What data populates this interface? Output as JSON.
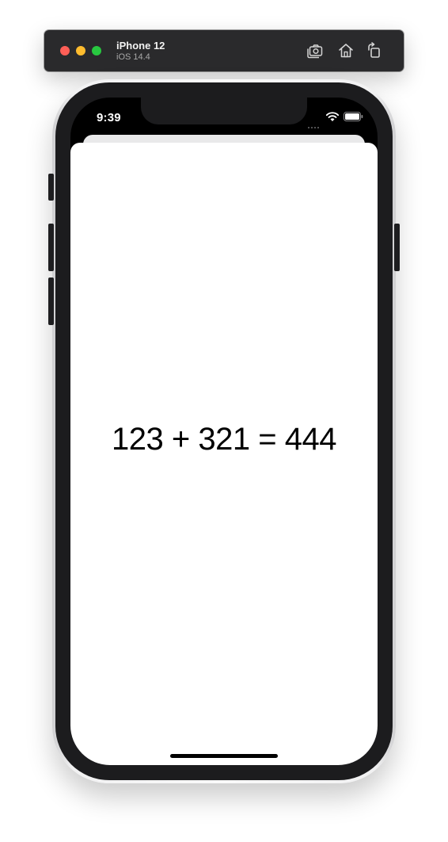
{
  "simulator": {
    "device_name": "iPhone 12",
    "os_version": "iOS 14.4",
    "toolbar_icons": [
      "screenshot-icon",
      "home-icon",
      "rotate-icon"
    ]
  },
  "status_bar": {
    "time": "9:39",
    "icons": [
      "cellular-signal-icon",
      "wifi-icon",
      "battery-icon"
    ]
  },
  "app": {
    "equation": "123 + 321 = 444"
  },
  "colors": {
    "titlebar": "#2a2a2c",
    "bezel": "#1c1c1e",
    "screen_bg": "#ffffff",
    "text": "#000000",
    "traffic_close": "#ff5f57",
    "traffic_minimize": "#febc2e",
    "traffic_zoom": "#28c840"
  }
}
